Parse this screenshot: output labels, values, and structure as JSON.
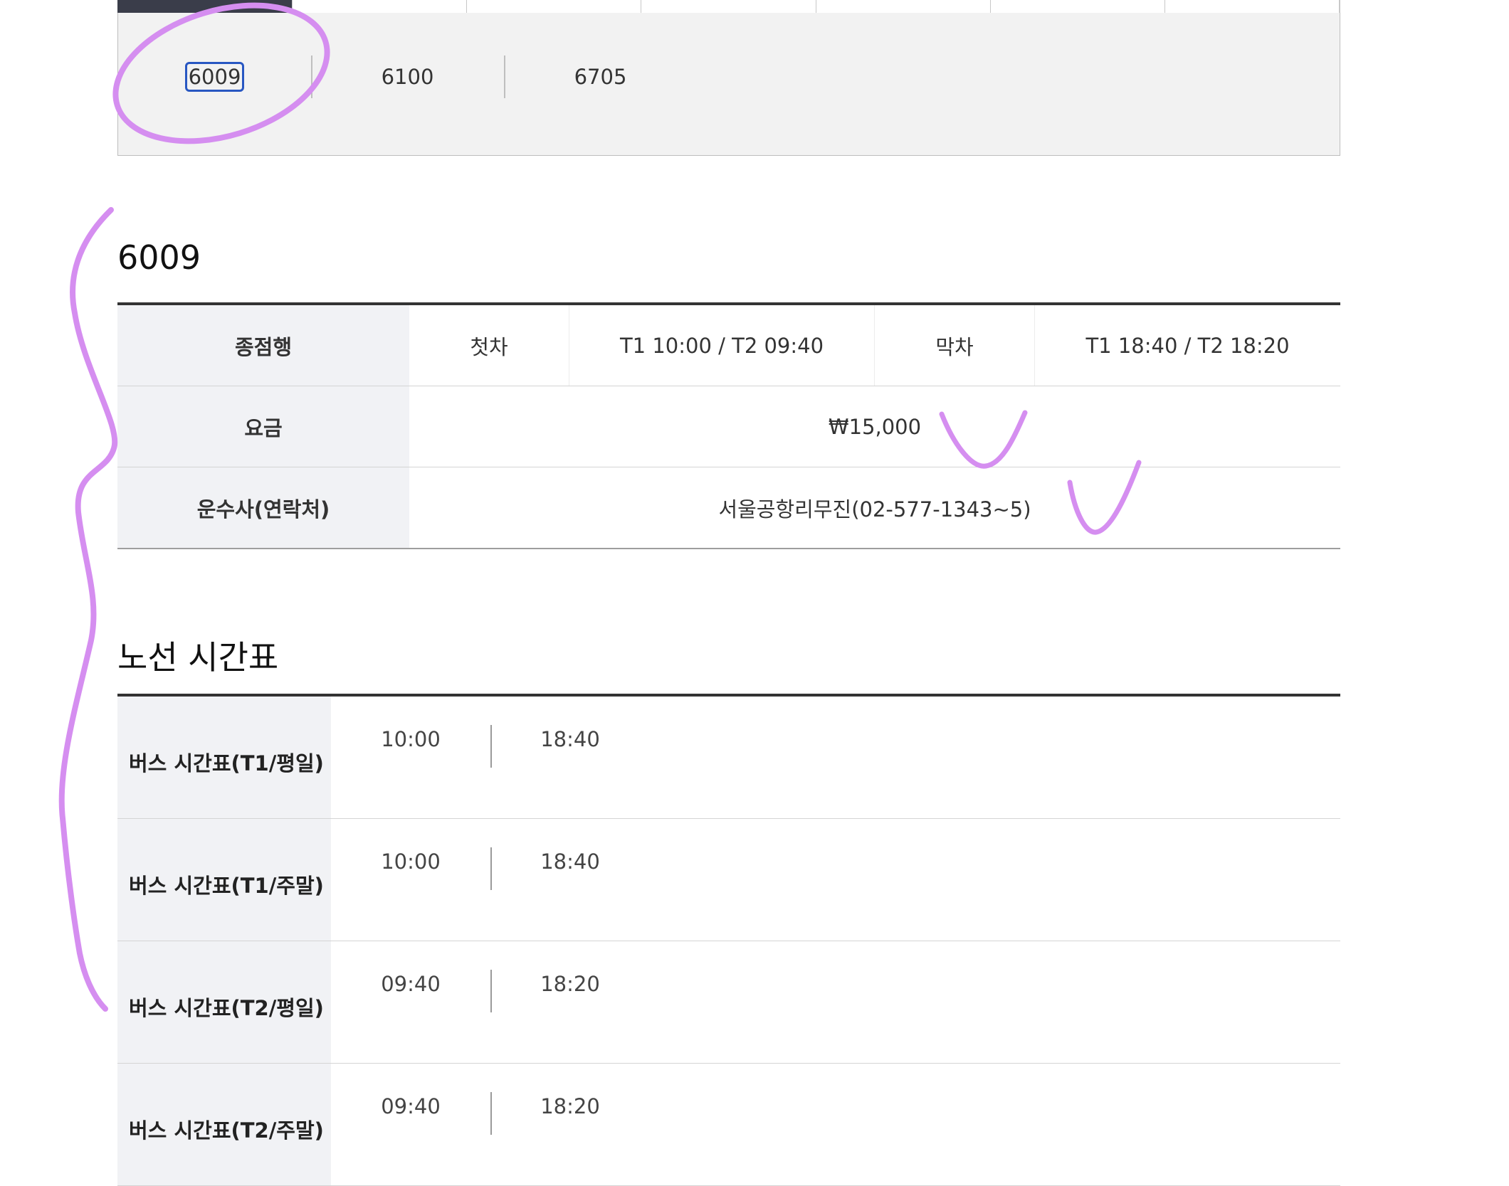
{
  "route_selector": {
    "items": [
      "6009",
      "6100",
      "6705"
    ],
    "selected": "6009"
  },
  "route_info": {
    "title": "6009",
    "rows": {
      "destination_label": "종점행",
      "first_bus_label": "첫차",
      "first_bus_value": "T1 10:00 / T2 09:40",
      "last_bus_label": "막차",
      "last_bus_value": "T1 18:40 / T2 18:20",
      "fare_label": "요금",
      "fare_value": "₩15,000",
      "operator_label": "운수사(연락처)",
      "operator_value": "서울공항리무진(02-577-1343~5)"
    }
  },
  "timetable": {
    "title": "노선 시간표",
    "rows": [
      {
        "label": "버스 시간표(T1/평일)",
        "times": [
          "10:00",
          "18:40"
        ]
      },
      {
        "label": "버스 시간표(T1/주말)",
        "times": [
          "10:00",
          "18:40"
        ]
      },
      {
        "label": "버스 시간표(T2/평일)",
        "times": [
          "09:40",
          "18:20"
        ]
      },
      {
        "label": "버스 시간표(T2/주말)",
        "times": [
          "09:40",
          "18:20"
        ]
      }
    ]
  },
  "colors": {
    "annotation": "#d58ef0",
    "focus": "#2857c2",
    "header_bg": "#f1f2f5",
    "active_tab": "#3a3d4a"
  }
}
